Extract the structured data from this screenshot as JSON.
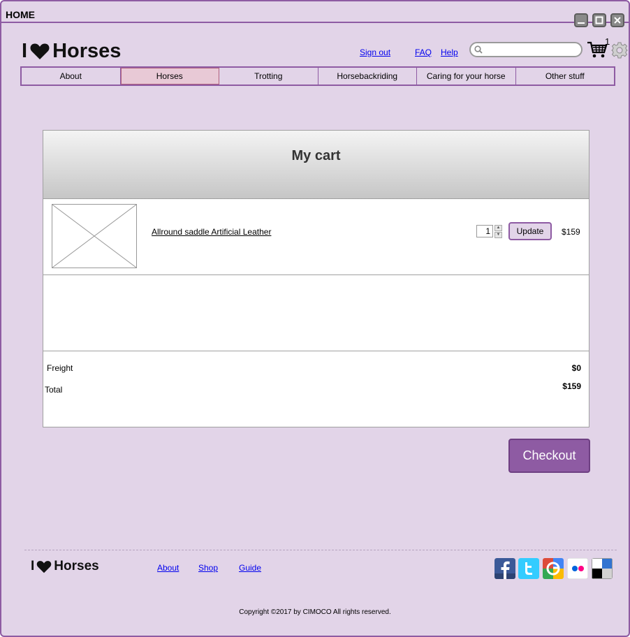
{
  "window": {
    "title": "HOME"
  },
  "header": {
    "logo": {
      "prefix": "I",
      "icon": "heart-icon",
      "suffix": "Horses"
    },
    "links": [
      "Sign out",
      "FAQ",
      "Help"
    ],
    "search": {
      "value": "",
      "placeholder": "",
      "icon": "search-icon"
    },
    "cart": {
      "icon": "cart-icon",
      "count": "1"
    },
    "settings_icon": "gear-icon"
  },
  "nav": {
    "tabs": [
      "About",
      "Horses",
      "Trotting",
      "Horsebackriding",
      "Caring for your horse",
      "Other stuff"
    ],
    "active": "Horses"
  },
  "cart": {
    "title": "My cart",
    "items": [
      {
        "name": "Allround saddle Artificial Leather",
        "quantity": "1",
        "update_label": "Update",
        "price": "$159"
      }
    ],
    "freight_label": "Freight",
    "freight_value": "$0",
    "total_label": "Total",
    "total_value": "$159"
  },
  "checkout_label": "Checkout",
  "footer": {
    "logo": {
      "prefix": "I",
      "icon": "heart-icon",
      "suffix": "Horses"
    },
    "links": [
      "About",
      "Shop",
      "Guide"
    ],
    "social": [
      {
        "icon": "facebook-icon",
        "color": "#3b5998"
      },
      {
        "icon": "twitter-icon",
        "color": "#33ccff"
      },
      {
        "icon": "google-icon",
        "color": "#dd4b39"
      },
      {
        "icon": "flickr-icon",
        "color": "#ff0084"
      },
      {
        "icon": "delicious-icon",
        "color": "#3274d1"
      }
    ],
    "copyright": "Copyright ©2017 by CIMOCO All rights reserved."
  },
  "colors": {
    "accent": "#8e5ba3",
    "background": "#e2d4e8",
    "link": "#0000ee"
  }
}
